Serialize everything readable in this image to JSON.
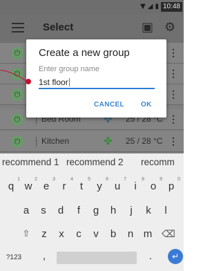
{
  "status_bar": {
    "wifi_icon": "wifi-icon",
    "signal_icon": "signal-icon",
    "battery_icon": "battery-icon",
    "time": "10:48"
  },
  "app_bar": {
    "menu_icon": "menu-icon",
    "title": "Select",
    "action_icon_1": "calendar-icon",
    "action_icon_2": "gear-icon"
  },
  "rooms": [
    {
      "name": "Bed Room",
      "temp": "25 / 28 °C"
    },
    {
      "name": "Kitchen",
      "temp": "25 / 28 °C"
    }
  ],
  "dialog": {
    "title": "Create a new group",
    "input_label": "Enter group name",
    "input_value": "1st floor",
    "cancel_label": "CANCEL",
    "ok_label": "OK"
  },
  "suggestions": [
    "recommend 1",
    "recommend 2",
    "recomm"
  ],
  "keyboard": {
    "row1": [
      {
        "key": "q",
        "hint": "1"
      },
      {
        "key": "w",
        "hint": "2"
      },
      {
        "key": "e",
        "hint": "3"
      },
      {
        "key": "r",
        "hint": "4"
      },
      {
        "key": "t",
        "hint": "5"
      },
      {
        "key": "y",
        "hint": "6"
      },
      {
        "key": "u",
        "hint": "7"
      },
      {
        "key": "i",
        "hint": "8"
      },
      {
        "key": "o",
        "hint": "9"
      },
      {
        "key": "p",
        "hint": "0"
      }
    ],
    "row2": [
      "a",
      "s",
      "d",
      "f",
      "g",
      "h",
      "j",
      "k",
      "l"
    ],
    "row3": [
      "z",
      "x",
      "c",
      "v",
      "b",
      "n",
      "m"
    ],
    "symbols_label": "?123",
    "comma_label": ",",
    "period_label": ".",
    "shift_icon": "shift-icon",
    "backspace_icon": "backspace-icon",
    "enter_icon": "enter-icon"
  },
  "colors": {
    "accent": "#2d7fd4",
    "callout": "#c8102e"
  }
}
